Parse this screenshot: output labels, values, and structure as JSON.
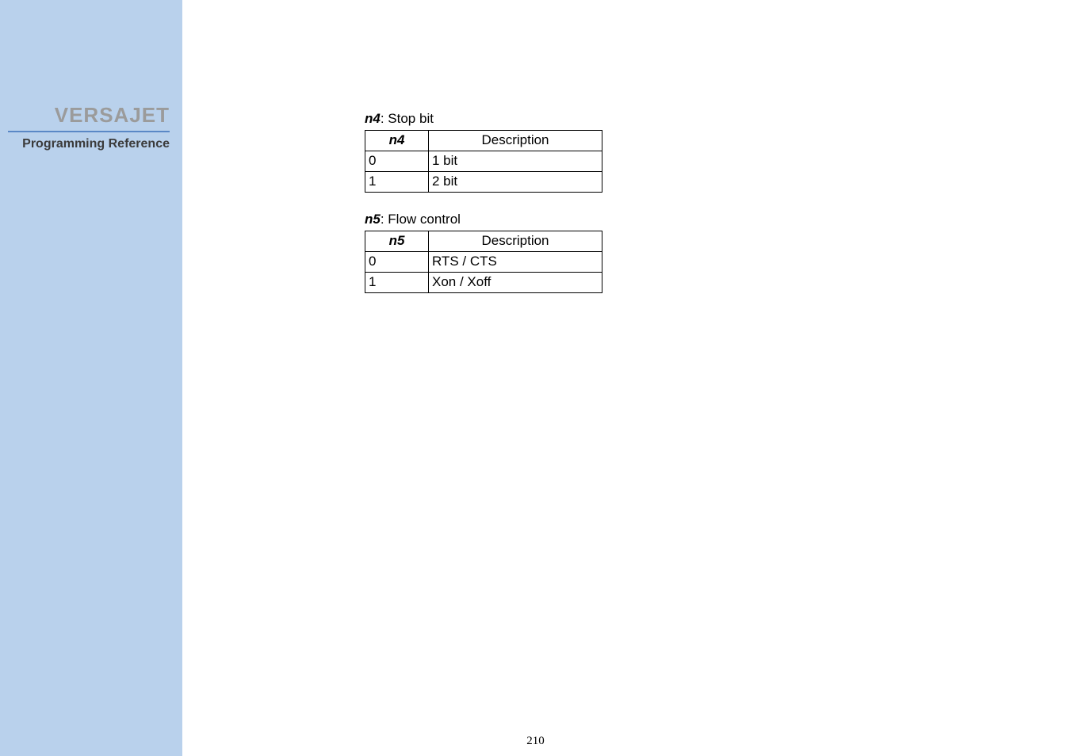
{
  "sidebar": {
    "brand": "VERSAJET",
    "subtitle": "Programming Reference"
  },
  "content": {
    "section1": {
      "param": "n4",
      "label_rest": ": Stop bit",
      "headers": {
        "c1": "n4",
        "c2": "Description"
      },
      "rows": [
        {
          "v": "0",
          "d": "1 bit"
        },
        {
          "v": "1",
          "d": "2 bit"
        }
      ]
    },
    "section2": {
      "param": "n5",
      "label_rest": ": Flow control",
      "headers": {
        "c1": "n5",
        "c2": "Description"
      },
      "rows": [
        {
          "v": "0",
          "d": "RTS / CTS"
        },
        {
          "v": "1",
          "d": "Xon / Xoff"
        }
      ]
    }
  },
  "page_number": "210"
}
